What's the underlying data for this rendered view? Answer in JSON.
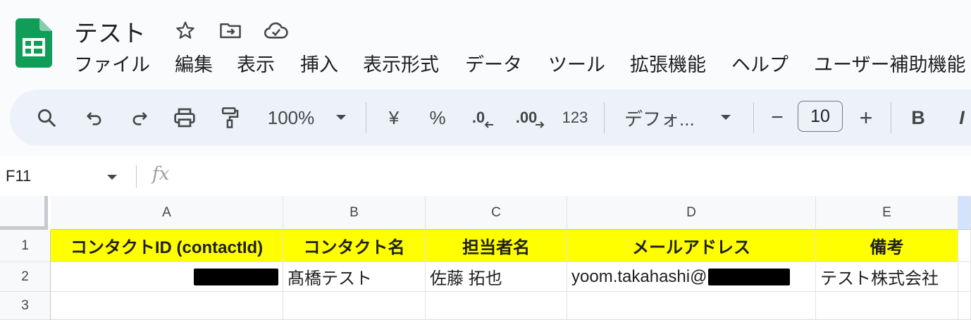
{
  "document": {
    "title": "テスト"
  },
  "menu": [
    "ファイル",
    "編集",
    "表示",
    "挿入",
    "表示形式",
    "データ",
    "ツール",
    "拡張機能",
    "ヘルプ",
    "ユーザー補助機能"
  ],
  "toolbar": {
    "zoom": "100%",
    "currency": "¥",
    "percent": "%",
    "decrease_decimal": ".0",
    "increase_decimal": ".00",
    "more_formats": "123",
    "font": "デフォ...",
    "minus": "−",
    "font_size": "10",
    "plus": "+",
    "bold": "B",
    "italic": "I"
  },
  "formula_bar": {
    "cell_ref": "F11",
    "fx": "fx"
  },
  "grid": {
    "columns": [
      "A",
      "B",
      "C",
      "D",
      "E"
    ],
    "rows": [
      "1",
      "2",
      "3"
    ],
    "header_row": [
      "コンタクトID (contactId)",
      "コンタクト名",
      "担当者名",
      "メールアドレス",
      "備考"
    ],
    "data_row": {
      "b": "髙橋テスト",
      "c": "佐藤 拓也",
      "d": "yoom.takahashi@",
      "e": "テスト株式会社"
    }
  },
  "colors": {
    "header_fill": "#ffff00",
    "accent": "#0f9d58"
  }
}
